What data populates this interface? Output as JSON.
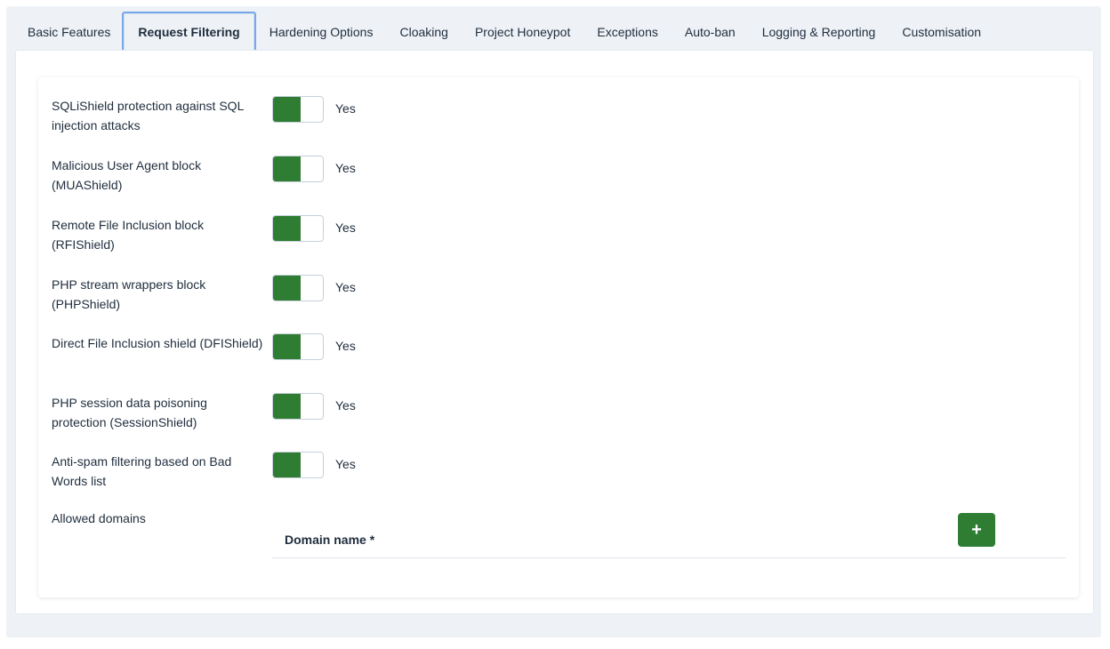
{
  "tabs": [
    {
      "label": "Basic Features"
    },
    {
      "label": "Request Filtering",
      "active": true
    },
    {
      "label": "Hardening Options"
    },
    {
      "label": "Cloaking"
    },
    {
      "label": "Project Honeypot"
    },
    {
      "label": "Exceptions"
    },
    {
      "label": "Auto-ban"
    },
    {
      "label": "Logging & Reporting"
    },
    {
      "label": "Customisation"
    }
  ],
  "settings": [
    {
      "label": "SQLiShield protection against SQL injection attacks",
      "value": "Yes",
      "enabled": true
    },
    {
      "label": "Malicious User Agent block (MUAShield)",
      "value": "Yes",
      "enabled": true
    },
    {
      "label": "Remote File Inclusion block (RFIShield)",
      "value": "Yes",
      "enabled": true
    },
    {
      "label": "PHP stream wrappers block (PHPShield)",
      "value": "Yes",
      "enabled": true
    },
    {
      "label": "Direct File Inclusion shield (DFIShield)",
      "value": "Yes",
      "enabled": true
    },
    {
      "label": "PHP session data poisoning protection (SessionShield)",
      "value": "Yes",
      "enabled": true
    },
    {
      "label": "Anti-spam filtering based on Bad Words list",
      "value": "Yes",
      "enabled": true
    }
  ],
  "domains": {
    "label": "Allowed domains",
    "column_header": "Domain name *",
    "add_icon": "+",
    "add_icon_name": "plus-icon"
  },
  "colors": {
    "toggle_on": "#2e7d32",
    "add_button": "#2e7d32",
    "active_tab_border": "#7aa7e6"
  }
}
